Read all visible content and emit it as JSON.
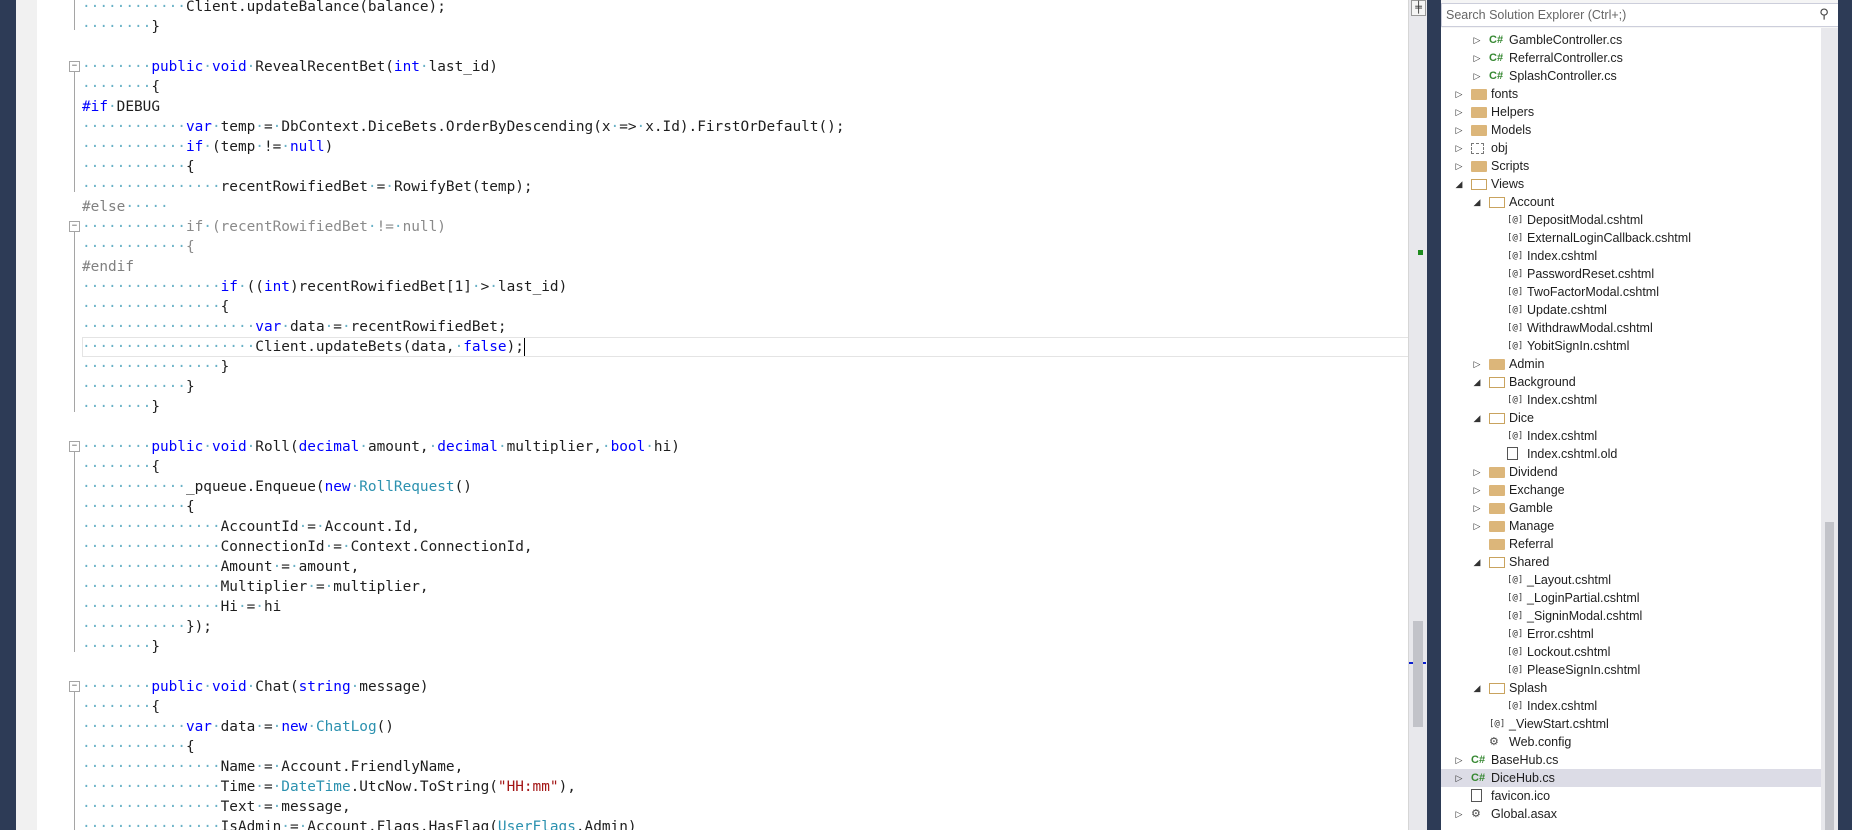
{
  "editor": {
    "lines": [
      {
        "indent": 12,
        "html": "Client.updateBalance(balance);"
      },
      {
        "indent": 8,
        "html": "}"
      },
      {
        "indent": 0,
        "html": ""
      },
      {
        "indent": 8,
        "html": "<span class=\"kw\">public</span><span class=\"ws\">·</span><span class=\"kw\">void</span><span class=\"ws\">·</span>RevealRecentBet(<span class=\"kw\">int</span><span class=\"ws\">·</span>last_id)"
      },
      {
        "indent": 8,
        "html": "{"
      },
      {
        "indent": 0,
        "html": "<span class=\"kw\">#if</span><span class=\"ws\">·</span>DEBUG"
      },
      {
        "indent": 12,
        "html": "<span class=\"kw\">var</span><span class=\"ws\">·</span>temp<span class=\"ws\">·</span>=<span class=\"ws\">·</span>DbContext.DiceBets.OrderByDescending(x<span class=\"ws\">·</span>=&gt;<span class=\"ws\">·</span>x.Id).FirstOrDefault();"
      },
      {
        "indent": 12,
        "html": "<span class=\"kw\">if</span><span class=\"ws\">·</span>(temp<span class=\"ws\">·</span>!=<span class=\"ws\">·</span><span class=\"kw\">null</span>)"
      },
      {
        "indent": 12,
        "html": "{"
      },
      {
        "indent": 16,
        "html": "recentRowifiedBet<span class=\"ws\">·</span>=<span class=\"ws\">·</span>RowifyBet(temp);"
      },
      {
        "indent": 0,
        "html": "<span class=\"pp\">#else</span><span class=\"ws\">·····</span>"
      },
      {
        "indent": 12,
        "html": "<span class=\"gr\">if</span><span class=\"ws\">·</span><span class=\"gr\">(recentRowifiedBet</span><span class=\"ws\">·</span><span class=\"gr\">!=</span><span class=\"ws\">·</span><span class=\"gr\">null)</span>"
      },
      {
        "indent": 12,
        "html": "<span class=\"gr\">{</span>"
      },
      {
        "indent": 0,
        "html": "<span class=\"pp\">#endif</span>"
      },
      {
        "indent": 16,
        "html": "<span class=\"kw\">if</span><span class=\"ws\">·</span>((<span class=\"kw\">int</span>)recentRowifiedBet[1]<span class=\"ws\">·</span>&gt;<span class=\"ws\">·</span>last_id)"
      },
      {
        "indent": 16,
        "html": "{"
      },
      {
        "indent": 20,
        "html": "<span class=\"kw\">var</span><span class=\"ws\">·</span>data<span class=\"ws\">·</span>=<span class=\"ws\">·</span>recentRowifiedBet;"
      },
      {
        "indent": 20,
        "html": "Client.updateBets(data,<span class=\"ws\">·</span><span class=\"kw\">false</span>);<span class=\"caret\"></span>",
        "current": true
      },
      {
        "indent": 16,
        "html": "}"
      },
      {
        "indent": 12,
        "html": "}"
      },
      {
        "indent": 8,
        "html": "}"
      },
      {
        "indent": 0,
        "html": ""
      },
      {
        "indent": 8,
        "html": "<span class=\"kw\">public</span><span class=\"ws\">·</span><span class=\"kw\">void</span><span class=\"ws\">·</span>Roll(<span class=\"kw\">decimal</span><span class=\"ws\">·</span>amount,<span class=\"ws\">·</span><span class=\"kw\">decimal</span><span class=\"ws\">·</span>multiplier,<span class=\"ws\">·</span><span class=\"kw\">bool</span><span class=\"ws\">·</span>hi)"
      },
      {
        "indent": 8,
        "html": "{"
      },
      {
        "indent": 12,
        "html": "_pqueue.Enqueue(<span class=\"kw\">new</span><span class=\"ws\">·</span><span class=\"ty\">RollRequest</span>()"
      },
      {
        "indent": 12,
        "html": "{"
      },
      {
        "indent": 16,
        "html": "AccountId<span class=\"ws\">·</span>=<span class=\"ws\">·</span>Account.Id,"
      },
      {
        "indent": 16,
        "html": "ConnectionId<span class=\"ws\">·</span>=<span class=\"ws\">·</span>Context.ConnectionId,"
      },
      {
        "indent": 16,
        "html": "Amount<span class=\"ws\">·</span>=<span class=\"ws\">·</span>amount,"
      },
      {
        "indent": 16,
        "html": "Multiplier<span class=\"ws\">·</span>=<span class=\"ws\">·</span>multiplier,"
      },
      {
        "indent": 16,
        "html": "Hi<span class=\"ws\">·</span>=<span class=\"ws\">·</span>hi"
      },
      {
        "indent": 12,
        "html": "});"
      },
      {
        "indent": 8,
        "html": "}"
      },
      {
        "indent": 0,
        "html": ""
      },
      {
        "indent": 8,
        "html": "<span class=\"kw\">public</span><span class=\"ws\">·</span><span class=\"kw\">void</span><span class=\"ws\">·</span>Chat(<span class=\"kw\">string</span><span class=\"ws\">·</span>message)"
      },
      {
        "indent": 8,
        "html": "{"
      },
      {
        "indent": 12,
        "html": "<span class=\"kw\">var</span><span class=\"ws\">·</span>data<span class=\"ws\">·</span>=<span class=\"ws\">·</span><span class=\"kw\">new</span><span class=\"ws\">·</span><span class=\"ty\">ChatLog</span>()"
      },
      {
        "indent": 12,
        "html": "{"
      },
      {
        "indent": 16,
        "html": "Name<span class=\"ws\">·</span>=<span class=\"ws\">·</span>Account.FriendlyName,"
      },
      {
        "indent": 16,
        "html": "Time<span class=\"ws\">·</span>=<span class=\"ws\">·</span><span class=\"ty\">DateTime</span>.UtcNow.ToString(<span class=\"st\">\"HH:mm\"</span>),"
      },
      {
        "indent": 16,
        "html": "Text<span class=\"ws\">·</span>=<span class=\"ws\">·</span>message,"
      },
      {
        "indent": 16,
        "html": "IsAdmin<span class=\"ws\">·</span>=<span class=\"ws\">·</span>Account.Flags.HasFlag(<span class=\"ty\">UserFlags</span>.Admin)"
      }
    ],
    "fold_boxes": [
      3,
      11,
      22,
      34
    ]
  },
  "scrollbar": {
    "split_glyph": "╪"
  },
  "solution_explorer": {
    "search_placeholder": "Search Solution Explorer (Ctrl+;)",
    "search_icon": "search-icon",
    "items": [
      {
        "depth": 3,
        "expander": "collapsed",
        "icon": "cs",
        "label": "GambleController.cs"
      },
      {
        "depth": 3,
        "expander": "collapsed",
        "icon": "cs",
        "label": "ReferralController.cs"
      },
      {
        "depth": 3,
        "expander": "collapsed",
        "icon": "cs",
        "label": "SplashController.cs"
      },
      {
        "depth": 2,
        "expander": "collapsed",
        "icon": "folder",
        "label": "fonts"
      },
      {
        "depth": 2,
        "expander": "collapsed",
        "icon": "folder",
        "label": "Helpers"
      },
      {
        "depth": 2,
        "expander": "collapsed",
        "icon": "folder",
        "label": "Models"
      },
      {
        "depth": 2,
        "expander": "collapsed",
        "icon": "obj",
        "label": "obj"
      },
      {
        "depth": 2,
        "expander": "collapsed",
        "icon": "folder",
        "label": "Scripts"
      },
      {
        "depth": 2,
        "expander": "expanded",
        "icon": "folder-open",
        "label": "Views"
      },
      {
        "depth": 3,
        "expander": "expanded",
        "icon": "folder-open",
        "label": "Account"
      },
      {
        "depth": 4,
        "expander": "none",
        "icon": "razor",
        "label": "DepositModal.cshtml"
      },
      {
        "depth": 4,
        "expander": "none",
        "icon": "razor",
        "label": "ExternalLoginCallback.cshtml"
      },
      {
        "depth": 4,
        "expander": "none",
        "icon": "razor",
        "label": "Index.cshtml"
      },
      {
        "depth": 4,
        "expander": "none",
        "icon": "razor",
        "label": "PasswordReset.cshtml"
      },
      {
        "depth": 4,
        "expander": "none",
        "icon": "razor",
        "label": "TwoFactorModal.cshtml"
      },
      {
        "depth": 4,
        "expander": "none",
        "icon": "razor",
        "label": "Update.cshtml"
      },
      {
        "depth": 4,
        "expander": "none",
        "icon": "razor",
        "label": "WithdrawModal.cshtml"
      },
      {
        "depth": 4,
        "expander": "none",
        "icon": "razor",
        "label": "YobitSignIn.cshtml"
      },
      {
        "depth": 3,
        "expander": "collapsed",
        "icon": "folder",
        "label": "Admin"
      },
      {
        "depth": 3,
        "expander": "expanded",
        "icon": "folder-open",
        "label": "Background"
      },
      {
        "depth": 4,
        "expander": "none",
        "icon": "razor",
        "label": "Index.cshtml"
      },
      {
        "depth": 3,
        "expander": "expanded",
        "icon": "folder-open",
        "label": "Dice"
      },
      {
        "depth": 4,
        "expander": "none",
        "icon": "razor",
        "label": "Index.cshtml"
      },
      {
        "depth": 4,
        "expander": "none",
        "icon": "file",
        "label": "Index.cshtml.old"
      },
      {
        "depth": 3,
        "expander": "collapsed",
        "icon": "folder",
        "label": "Dividend"
      },
      {
        "depth": 3,
        "expander": "collapsed",
        "icon": "folder",
        "label": "Exchange"
      },
      {
        "depth": 3,
        "expander": "collapsed",
        "icon": "folder",
        "label": "Gamble"
      },
      {
        "depth": 3,
        "expander": "collapsed",
        "icon": "folder",
        "label": "Manage"
      },
      {
        "depth": 3,
        "expander": "none",
        "icon": "folder",
        "label": "Referral"
      },
      {
        "depth": 3,
        "expander": "expanded",
        "icon": "folder-open",
        "label": "Shared"
      },
      {
        "depth": 4,
        "expander": "none",
        "icon": "razor",
        "label": "_Layout.cshtml"
      },
      {
        "depth": 4,
        "expander": "none",
        "icon": "razor",
        "label": "_LoginPartial.cshtml"
      },
      {
        "depth": 4,
        "expander": "none",
        "icon": "razor",
        "label": "_SigninModal.cshtml"
      },
      {
        "depth": 4,
        "expander": "none",
        "icon": "razor",
        "label": "Error.cshtml"
      },
      {
        "depth": 4,
        "expander": "none",
        "icon": "razor",
        "label": "Lockout.cshtml"
      },
      {
        "depth": 4,
        "expander": "none",
        "icon": "razor",
        "label": "PleaseSignIn.cshtml"
      },
      {
        "depth": 3,
        "expander": "expanded",
        "icon": "folder-open",
        "label": "Splash"
      },
      {
        "depth": 4,
        "expander": "none",
        "icon": "razor",
        "label": "Index.cshtml"
      },
      {
        "depth": 3,
        "expander": "none",
        "icon": "razor",
        "label": "_ViewStart.cshtml"
      },
      {
        "depth": 3,
        "expander": "none",
        "icon": "config",
        "label": "Web.config"
      },
      {
        "depth": 2,
        "expander": "collapsed",
        "icon": "cs",
        "label": "BaseHub.cs"
      },
      {
        "depth": 2,
        "expander": "collapsed",
        "icon": "cs",
        "label": "DiceHub.cs",
        "selected": true
      },
      {
        "depth": 2,
        "expander": "none",
        "icon": "file",
        "label": "favicon.ico"
      },
      {
        "depth": 2,
        "expander": "collapsed",
        "icon": "config",
        "label": "Global.asax"
      }
    ]
  },
  "colors": {
    "keyword": "#0000ff",
    "type": "#2b91af",
    "string": "#a31515",
    "preprocessor": "#808080",
    "chrome": "#2d3b56"
  }
}
